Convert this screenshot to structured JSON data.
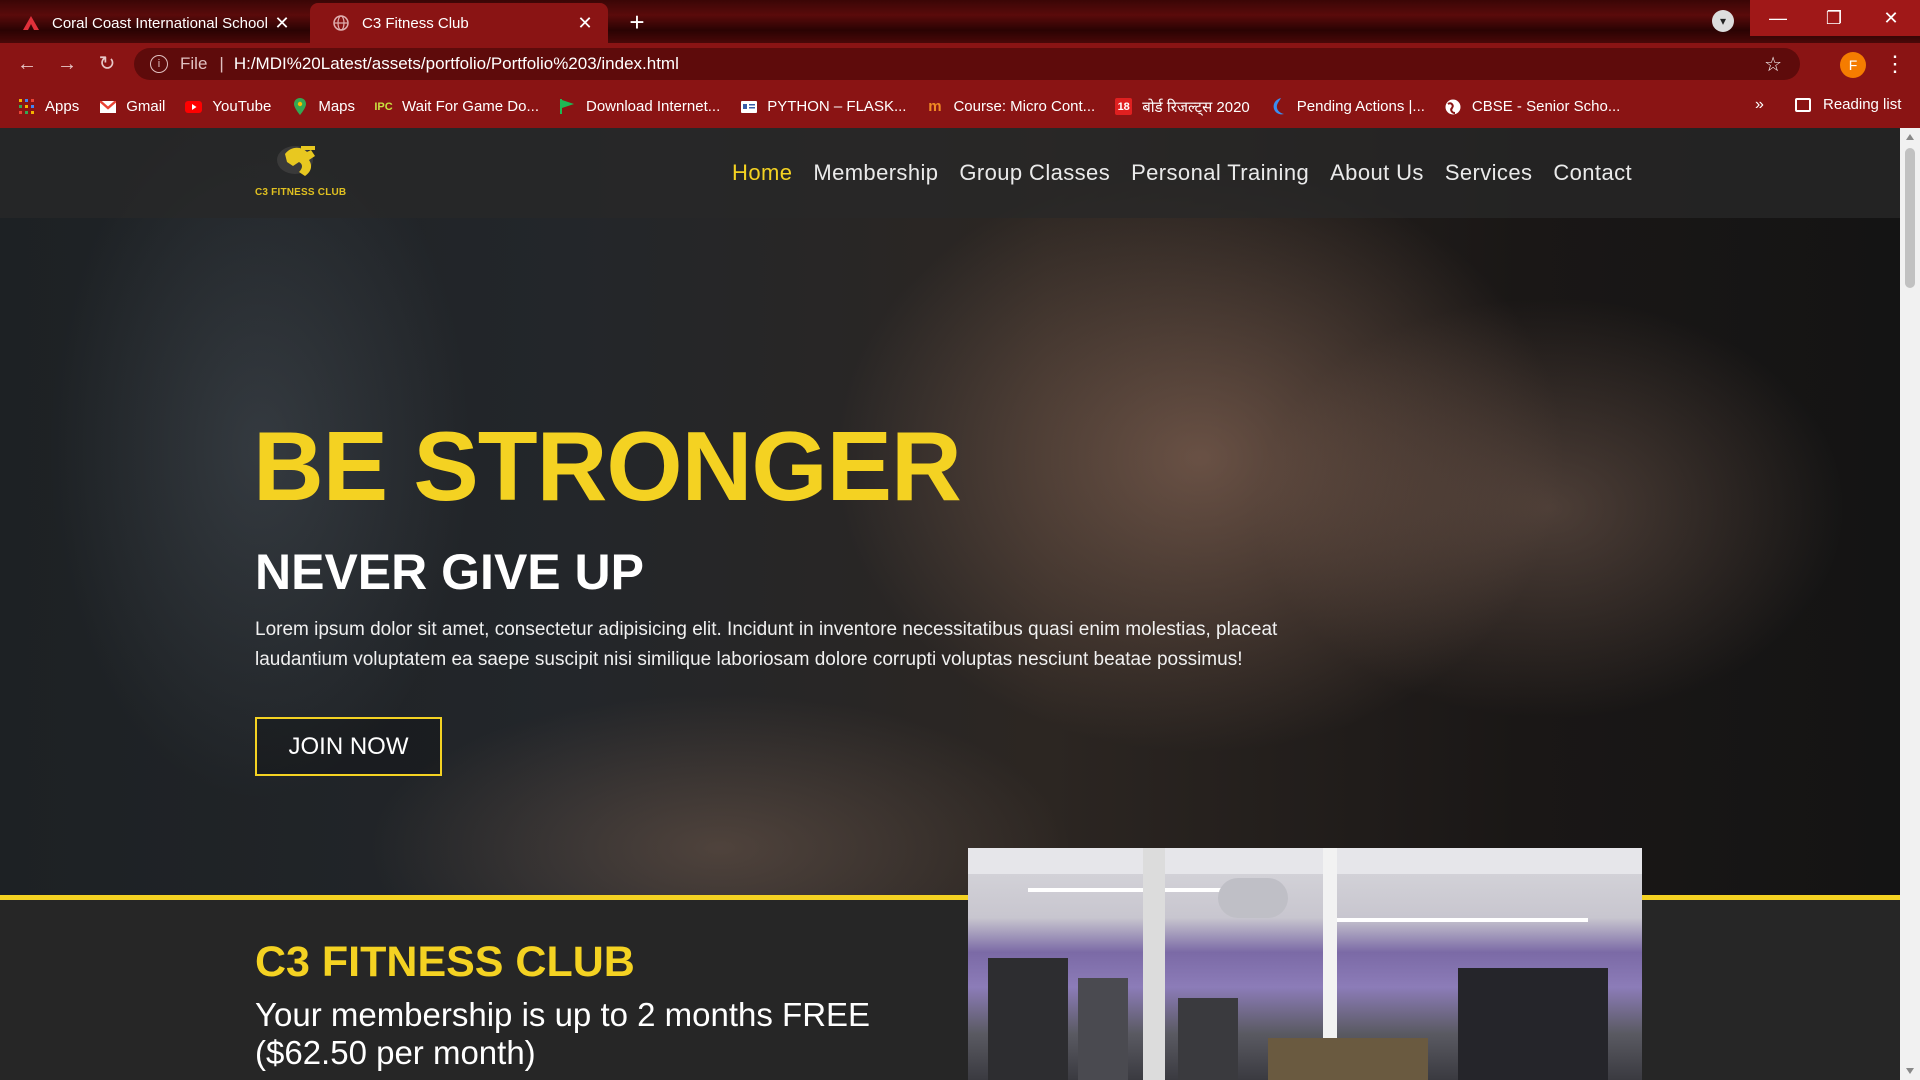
{
  "browser": {
    "tabs": [
      {
        "title": "Coral Coast International School",
        "active": false,
        "favicon": "school-icon"
      },
      {
        "title": "C3 Fitness Club",
        "active": true,
        "favicon": "globe-icon"
      }
    ],
    "address": {
      "scheme_label": "File",
      "url": "H:/MDI%20Latest/assets/portfolio/Portfolio%203/index.html"
    },
    "profile_initial": "F",
    "bookmarks": [
      {
        "label": "Apps",
        "icon": "apps-grid-icon"
      },
      {
        "label": "Gmail",
        "icon": "gmail-icon"
      },
      {
        "label": "YouTube",
        "icon": "youtube-icon"
      },
      {
        "label": "Maps",
        "icon": "maps-pin-icon"
      },
      {
        "label": "Wait For Game Do...",
        "icon": "ipc-icon"
      },
      {
        "label": "Download Internet...",
        "icon": "flag-icon"
      },
      {
        "label": "PYTHON – FLASK...",
        "icon": "id-card-icon"
      },
      {
        "label": "Course: Micro Cont...",
        "icon": "m-logo-icon"
      },
      {
        "label": "बोर्ड रिजल्ट्स 2020",
        "icon": "news18-icon"
      },
      {
        "label": "Pending Actions |...",
        "icon": "crescent-icon"
      },
      {
        "label": "CBSE - Senior Scho...",
        "icon": "globe-icon"
      }
    ],
    "bookmarks_overflow": "»",
    "reading_list": "Reading list"
  },
  "site": {
    "logo_text": "C3 FITNESS CLUB",
    "nav": [
      "Home",
      "Membership",
      "Group Classes",
      "Personal Training",
      "About Us",
      "Services",
      "Contact"
    ],
    "active_nav": "Home",
    "hero": {
      "headline": "BE STRONGER",
      "subheadline": "NEVER GIVE UP",
      "paragraph": "Lorem ipsum dolor sit amet, consectetur adipisicing elit. Incidunt in inventore necessitatibus quasi enim molestias, placeat laudantium voluptatem ea saepe suscipit nisi similique laboriosam dolore corrupti voluptas nesciunt beatae possimus!",
      "cta": "JOIN NOW"
    },
    "intro": {
      "title": "C3 FITNESS CLUB",
      "subtitle": "Your membership is up to 2 months FREE ($62.50 per month)"
    }
  },
  "colors": {
    "accent": "#f4d222",
    "browser_frame": "#8a1414",
    "page_bg": "#262626"
  }
}
